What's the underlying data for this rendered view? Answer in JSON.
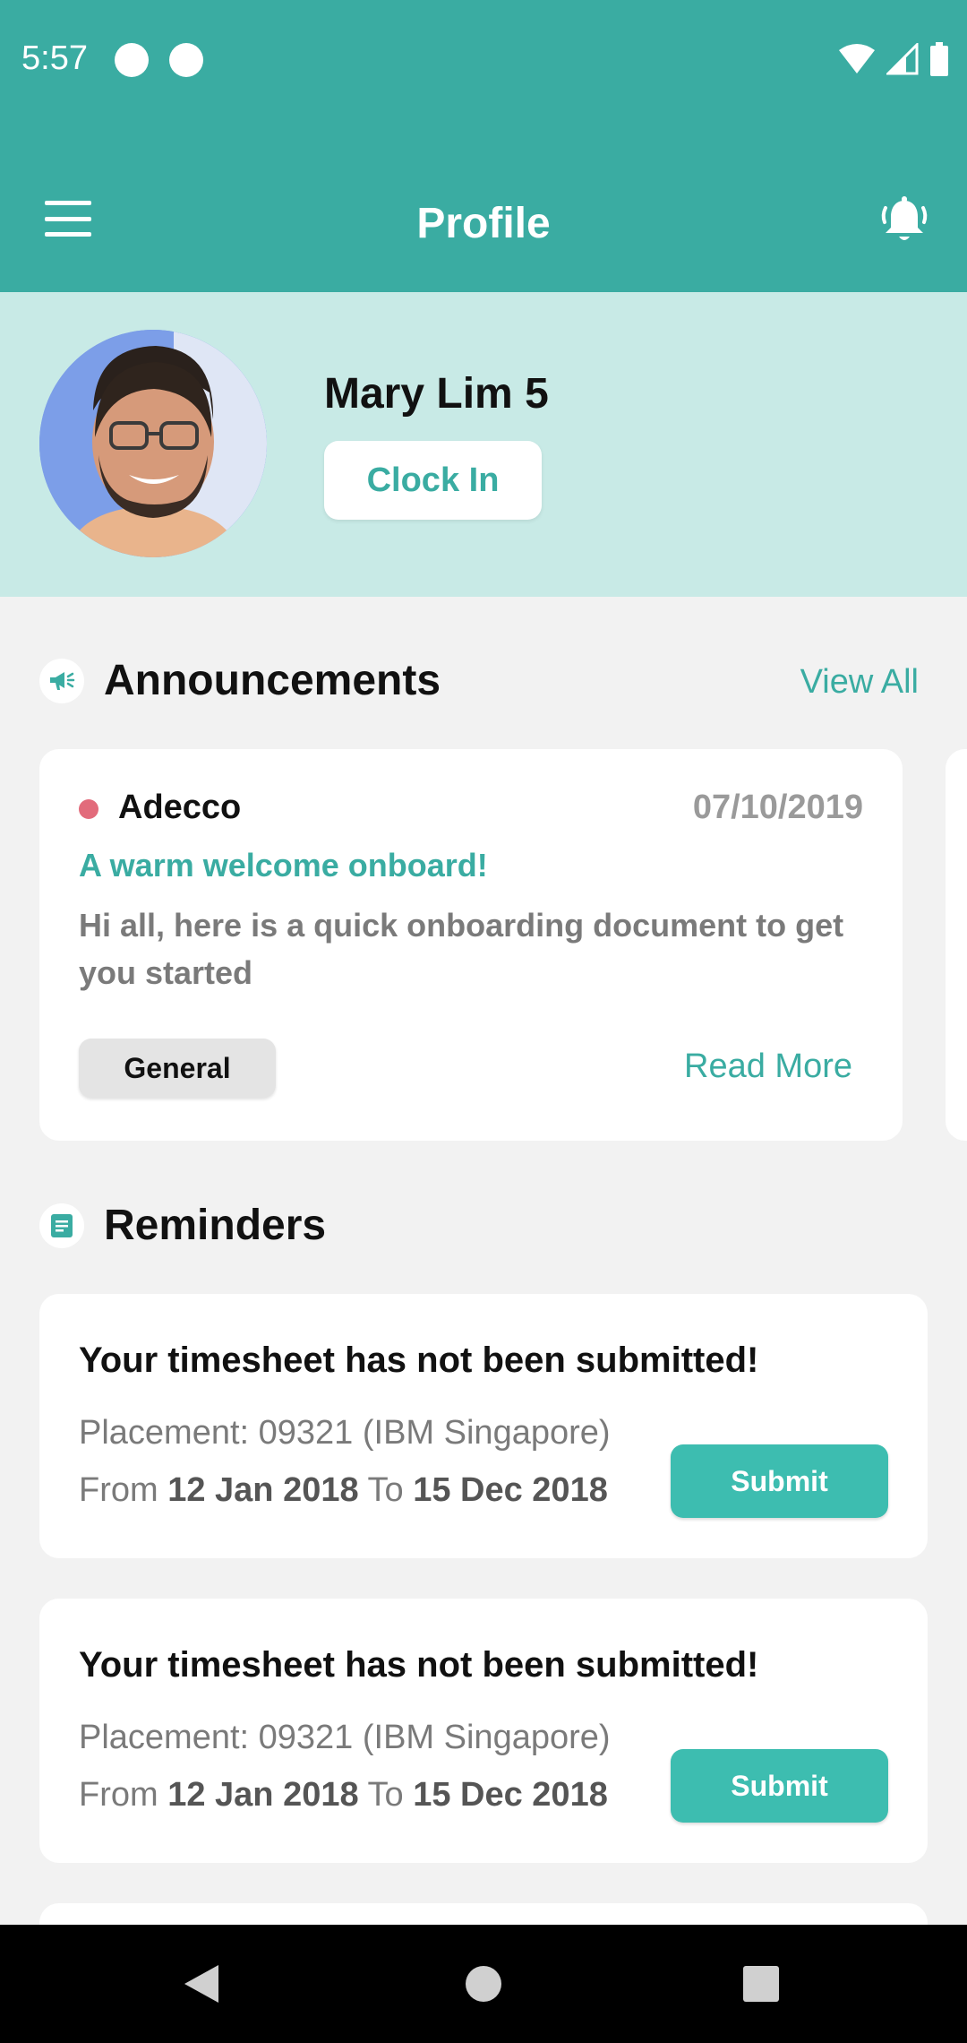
{
  "status_bar": {
    "time": "5:57"
  },
  "app_bar": {
    "title": "Profile"
  },
  "profile": {
    "name": "Mary Lim 5",
    "clock_in_label": "Clock In"
  },
  "announcements": {
    "title": "Announcements",
    "view_all_label": "View All",
    "items": [
      {
        "source": "Adecco",
        "date": "07/10/2019",
        "title": "A warm welcome onboard!",
        "body": "Hi all, here is a quick onboarding document to get you started",
        "tag": "General",
        "read_more_label": "Read More"
      }
    ]
  },
  "reminders": {
    "title": "Reminders",
    "items": [
      {
        "title": "Your timesheet has not been submitted!",
        "placement": "Placement: 09321 (IBM Singapore)",
        "from_label": "From",
        "from_date": "12 Jan 2018",
        "to_label": "To",
        "to_date": "15 Dec 2018",
        "submit_label": "Submit"
      },
      {
        "title": "Your timesheet has not been submitted!",
        "placement": "Placement: 09321 (IBM Singapore)",
        "from_label": "From",
        "from_date": "12 Jan 2018",
        "to_label": "To",
        "to_date": "15 Dec 2018",
        "submit_label": "Submit"
      }
    ]
  },
  "colors": {
    "primary": "#3aaca2",
    "profile_bg": "#c8eae6",
    "submit": "#3dbdb0",
    "source_dot": "#e26b7b",
    "page_bg": "#f2f2f2"
  },
  "icons": {
    "menu": "hamburger-menu-icon",
    "notifications": "bell-icon",
    "announcements": "megaphone-icon",
    "reminders": "document-icon",
    "nav_back": "back-triangle-icon",
    "nav_home": "home-circle-icon",
    "nav_recents": "recents-square-icon"
  }
}
